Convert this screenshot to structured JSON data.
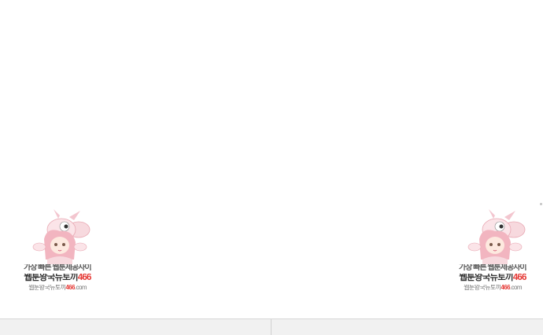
{
  "banners": [
    {
      "line1": "가장 빠른 웹툰제공사이트",
      "line2_text": "웹툰왕국뉴토끼",
      "line2_num": "466",
      "line3_text": "웹툰왕국뉴토끼",
      "line3_num": "466",
      "line3_suffix": ".com"
    },
    {
      "line1": "가장 빠른 웹툰제공사이트",
      "line2_text": "웹툰왕국뉴토끼",
      "line2_num": "466",
      "line3_text": "웹툰왕국뉴토끼",
      "line3_num": "466",
      "line3_suffix": ".com"
    }
  ],
  "bottom_nav": {
    "left_label": "",
    "right_label": ""
  },
  "colors": {
    "accent": "#e53935",
    "bar_bg": "#f1f1f1",
    "divider": "#d0d0d0"
  }
}
